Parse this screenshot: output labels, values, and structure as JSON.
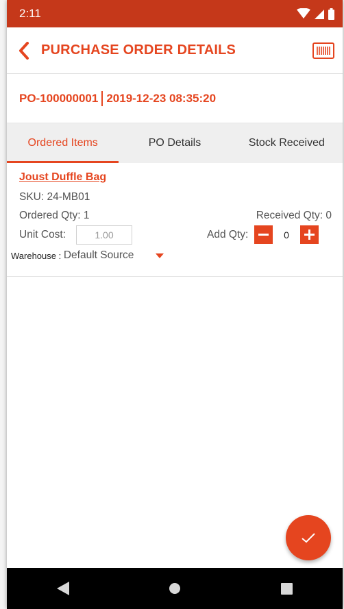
{
  "status_bar": {
    "time": "2:11"
  },
  "app_bar": {
    "title": "PURCHASE ORDER DETAILS"
  },
  "po": {
    "number": "PO-100000001",
    "date": "2019-12-23 08:35:20"
  },
  "tabs": [
    {
      "label": "Ordered Items",
      "active": true
    },
    {
      "label": "PO Details",
      "active": false
    },
    {
      "label": "Stock Received",
      "active": false
    }
  ],
  "items": [
    {
      "name": "Joust Duffle Bag",
      "sku_label": "SKU: 24-MB01",
      "ordered_label": "Ordered Qty: 1",
      "received_label": "Received Qty: 0",
      "unit_cost_label": "Unit Cost:",
      "unit_cost_value": "1.00",
      "add_qty_label": "Add Qty:",
      "add_qty_value": "0",
      "warehouse_label": "Warehouse",
      "warehouse_sep": " : ",
      "warehouse_value": "Default Source"
    }
  ],
  "colors": {
    "accent": "#e5451f",
    "status_bar": "#c5381a",
    "nav_bar": "#000000"
  }
}
